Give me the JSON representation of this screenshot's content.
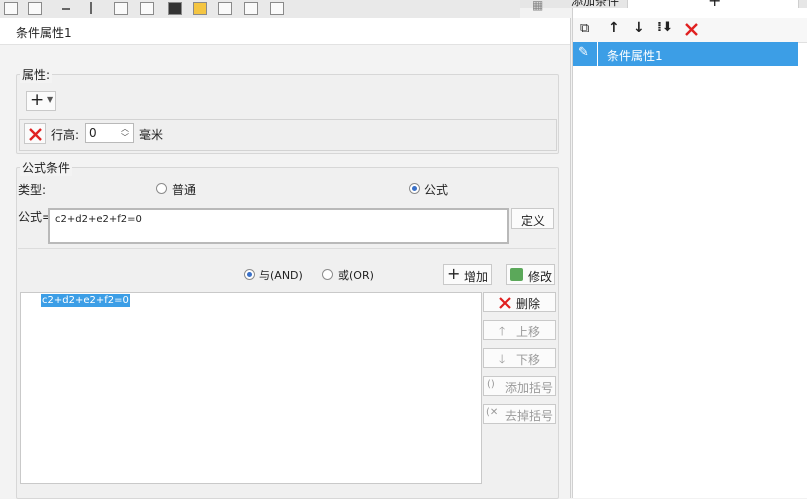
{
  "dialog": {
    "title": "条件属性1",
    "attr_section_label": "属性:",
    "row_height_label": "行高:",
    "row_height_value": "0",
    "row_height_unit": "毫米",
    "formula_section_label": "公式条件",
    "type_label": "类型:",
    "type_options": [
      "普通",
      "公式"
    ],
    "type_selected": "公式",
    "formula_label": "公式=",
    "formula_value": "c2+d2+e2+f2=0",
    "define_button": "定义",
    "logic_options": [
      "与(AND)",
      "或(OR)"
    ],
    "logic_selected": "与(AND)",
    "add_button": "增加",
    "modify_button": "修改",
    "condition_list": [
      "c2+d2+e2+f2=0"
    ],
    "side_buttons": {
      "delete": "删除",
      "move_up": "上移",
      "move_down": "下移",
      "add_bracket": "添加括号",
      "remove_bracket": "去掉括号"
    }
  },
  "right_panel": {
    "header_label": "添加条件",
    "items": [
      "条件属性1"
    ]
  },
  "colors": {
    "selection": "#3c9ee6",
    "delete_red": "#e02020",
    "radio_dot": "#3a70c7"
  }
}
